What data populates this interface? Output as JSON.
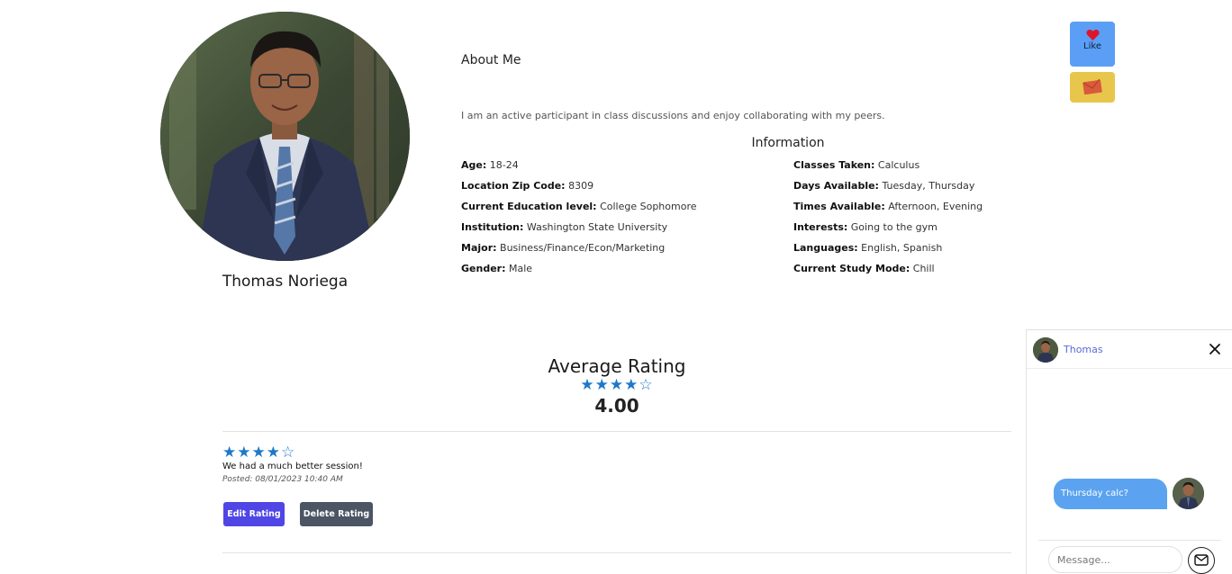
{
  "profile": {
    "name": "Thomas Noriega",
    "photo": "profile-photo-man-in-suit"
  },
  "about": {
    "title": "About Me",
    "text": "I am an active participant in class discussions and enjoy collaborating with my peers."
  },
  "information": {
    "title": "Information",
    "left": [
      {
        "label": "Age:",
        "value": "18-24"
      },
      {
        "label": "Location Zip Code:",
        "value": "8309"
      },
      {
        "label": "Current Education level:",
        "value": "College Sophomore"
      },
      {
        "label": "Institution:",
        "value": "Washington State University"
      },
      {
        "label": "Major:",
        "value": "Business/Finance/Econ/Marketing"
      },
      {
        "label": "Gender:",
        "value": "Male"
      }
    ],
    "right": [
      {
        "label": "Classes Taken:",
        "value": "Calculus"
      },
      {
        "label": "Days Available:",
        "value": "Tuesday, Thursday"
      },
      {
        "label": "Times Available:",
        "value": "Afternoon, Evening"
      },
      {
        "label": "Interests:",
        "value": "Going to the gym"
      },
      {
        "label": "Languages:",
        "value": "English, Spanish"
      },
      {
        "label": "Current Study Mode:",
        "value": "Chill"
      }
    ]
  },
  "actions": {
    "like_label": "Like",
    "like_icon": "heart-icon",
    "message_icon": "envelope-icon"
  },
  "rating": {
    "title": "Average Rating",
    "stars": "★★★★☆",
    "filled": 4,
    "max": 5,
    "value": "4.00"
  },
  "reviews": [
    {
      "stars": "★★★★☆",
      "filled": 4,
      "text": "We had a much better session!",
      "date": "Posted: 08/01/2023 10:40 AM",
      "edit_label": "Edit Rating",
      "delete_label": "Delete Rating"
    }
  ],
  "chat": {
    "name": "Thomas",
    "message": "Thursday calc?",
    "input_placeholder": "Message...",
    "close_icon": "close-icon",
    "send_icon": "envelope-icon"
  },
  "colors": {
    "like_bg": "#5b9ef5",
    "message_bg": "#e8c64c",
    "star": "#1e78c8",
    "edit_button": "#4f46e5",
    "delete_button": "#4b5563",
    "chat_bubble": "#5ba3f0",
    "chat_name": "#5a6ad6"
  }
}
